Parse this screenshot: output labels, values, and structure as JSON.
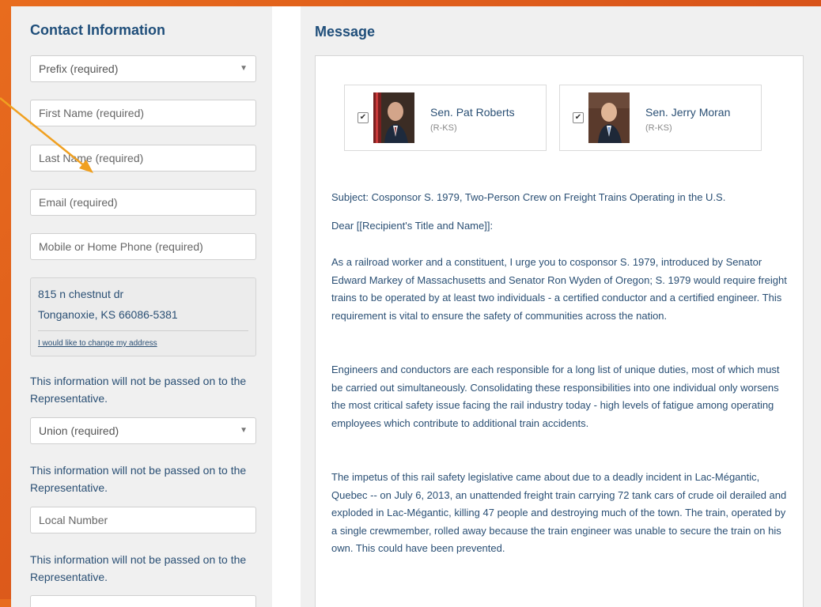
{
  "contact": {
    "title": "Contact Information",
    "prefix_placeholder": "Prefix (required)",
    "first_name_placeholder": "First Name (required)",
    "last_name_placeholder": "Last Name (required)",
    "email_placeholder": "Email (required)",
    "phone_placeholder": "Mobile or Home Phone (required)",
    "address": {
      "line1": "815 n chestnut dr",
      "line2": "Tonganoxie, KS 66086-5381",
      "change_link": "I would like to change my address"
    },
    "note": "This information will not be passed on to the Representative.",
    "union_placeholder": "Union (required)",
    "local_number_placeholder": "Local Number"
  },
  "message": {
    "title": "Message",
    "recipients": [
      {
        "name": "Sen. Pat Roberts",
        "party": "(R-KS)",
        "checked": true
      },
      {
        "name": "Sen. Jerry Moran",
        "party": "(R-KS)",
        "checked": true
      }
    ],
    "subject": "Subject: Cosponsor S. 1979, Two-Person Crew on Freight Trains Operating in the U.S.",
    "salutation": "Dear [[Recipient's Title and Name]]:",
    "paragraphs": [
      "As a railroad worker and a constituent, I urge you to cosponsor S. 1979, introduced by Senator Edward Markey of Massachusetts and Senator Ron Wyden of Oregon; S. 1979 would require freight trains to be operated by at least two individuals - a certified conductor and a certified engineer. This requirement is vital to ensure the safety of communities across the nation.",
      "Engineers and conductors are each responsible for a long list of unique duties, most of which must be carried out simultaneously. Consolidating these responsibilities into one individual only worsens the most critical safety issue facing the rail industry today - high levels of fatigue among operating employees which contribute to additional train accidents.",
      "The impetus of this rail safety legislative came about due to a deadly incident in Lac-Mégantic, Quebec -- on July 6, 2013, an unattended freight train carrying 72 tank cars of crude oil derailed and exploded in Lac-Mégantic, killing 47 people and destroying much of the town. The train, operated by a single crewmember, rolled away because the train engineer was unable to secure the train on his own. This could have been prevented."
    ]
  },
  "colors": {
    "accent_orange": "#e86c1e",
    "heading_blue": "#1f4e7a",
    "text_blue": "#2a4f74"
  }
}
